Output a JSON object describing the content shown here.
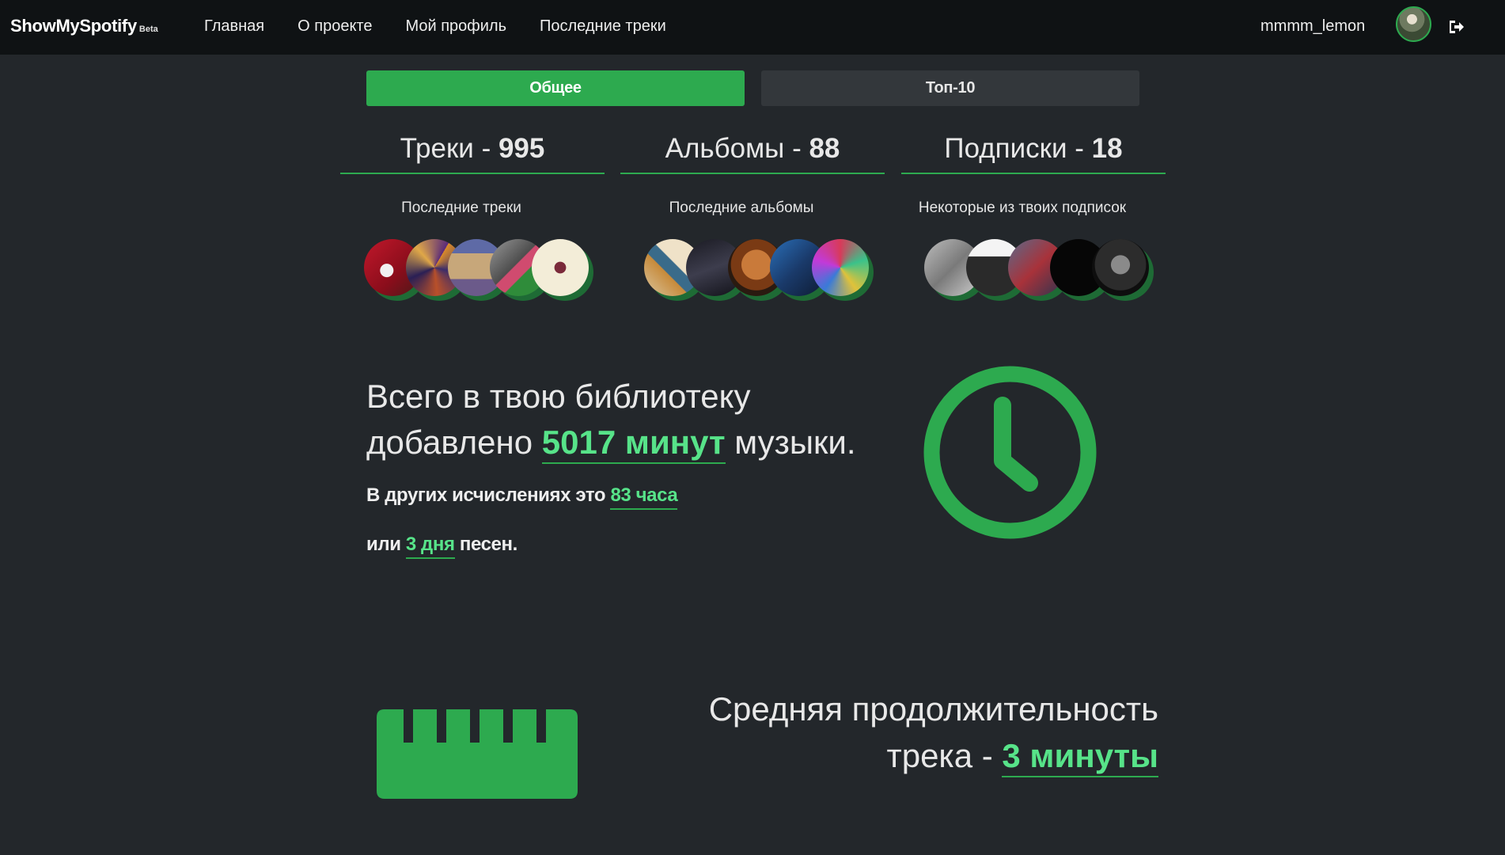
{
  "navbar": {
    "brand": "ShowMySpotify",
    "badge": "Beta",
    "links": [
      "Главная",
      "О проекте",
      "Мой профиль",
      "Последние треки"
    ],
    "username": "mmmm_lemon",
    "logout_icon": "sign-out-icon"
  },
  "tabs": {
    "general": "Общее",
    "top10": "Топ-10",
    "active": "general"
  },
  "stats": [
    {
      "label": "Треки - ",
      "value": "995",
      "sub": "Последние треки"
    },
    {
      "label": "Альбомы - ",
      "value": "88",
      "sub": "Последние альбомы"
    },
    {
      "label": "Подписки - ",
      "value": "18",
      "sub": "Некоторые из твоих подписок"
    }
  ],
  "library": {
    "line1": "Всего в твою библиотеку",
    "line2_pre": "добавлено ",
    "minutes": "5017 минут",
    "line2_post": " музыки.",
    "hours_pre": "В других исчислениях это ",
    "hours": "83 часа",
    "days_pre": "или ",
    "days": "3 дня",
    "days_post": " песен.",
    "icon": "clock-icon"
  },
  "duration": {
    "line1": "Средняя продолжительность",
    "line2_pre": "трека - ",
    "value": "3 минуты",
    "icon": "ruler-icon"
  },
  "colors": {
    "accent": "#2daa4f",
    "highlight": "#57e389",
    "background": "#23272b",
    "navbar": "#0f1214"
  }
}
